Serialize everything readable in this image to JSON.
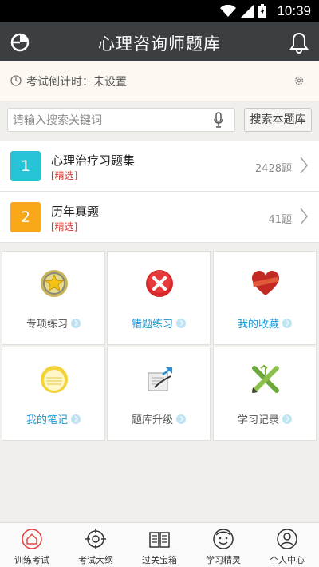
{
  "statusbar": {
    "time": "10:39"
  },
  "header": {
    "title": "心理咨询师题库"
  },
  "countdown": {
    "text": "考试倒计时：未设置"
  },
  "search": {
    "placeholder": "请输入搜索关键词",
    "button": "搜索本题库"
  },
  "banks": [
    {
      "number": "1",
      "name": "心理治疗习题集",
      "tag": "[精选]",
      "count": "2428题",
      "color": "#27c3d6"
    },
    {
      "number": "2",
      "name": "历年真题",
      "tag": "[精选]",
      "count": "41题",
      "color": "#f7a718"
    }
  ],
  "tiles": [
    {
      "label": "专项练习",
      "icon": "star-medal-icon",
      "color": "#555555"
    },
    {
      "label": "错题练习",
      "icon": "red-x-icon",
      "color": "#1a95d3"
    },
    {
      "label": "我的收藏",
      "icon": "heart-icon",
      "color": "#1a95d3"
    },
    {
      "label": "我的笔记",
      "icon": "notepad-icon",
      "color": "#1a95d3"
    },
    {
      "label": "题库升级",
      "icon": "upgrade-icon",
      "color": "#555555"
    },
    {
      "label": "学习记录",
      "icon": "pencil-record-icon",
      "color": "#555555"
    }
  ],
  "bottomnav": [
    {
      "label": "训练考试",
      "icon": "home-icon",
      "active": true
    },
    {
      "label": "考试大纲",
      "icon": "target-icon",
      "active": false
    },
    {
      "label": "过关宝箱",
      "icon": "book-icon",
      "active": false
    },
    {
      "label": "学习精灵",
      "icon": "smiley-icon",
      "active": false
    },
    {
      "label": "个人中心",
      "icon": "user-icon",
      "active": false
    }
  ],
  "colors": {
    "header_bg": "#3c3f41",
    "accent_red": "#d0302a",
    "link_blue": "#1a95d3"
  }
}
